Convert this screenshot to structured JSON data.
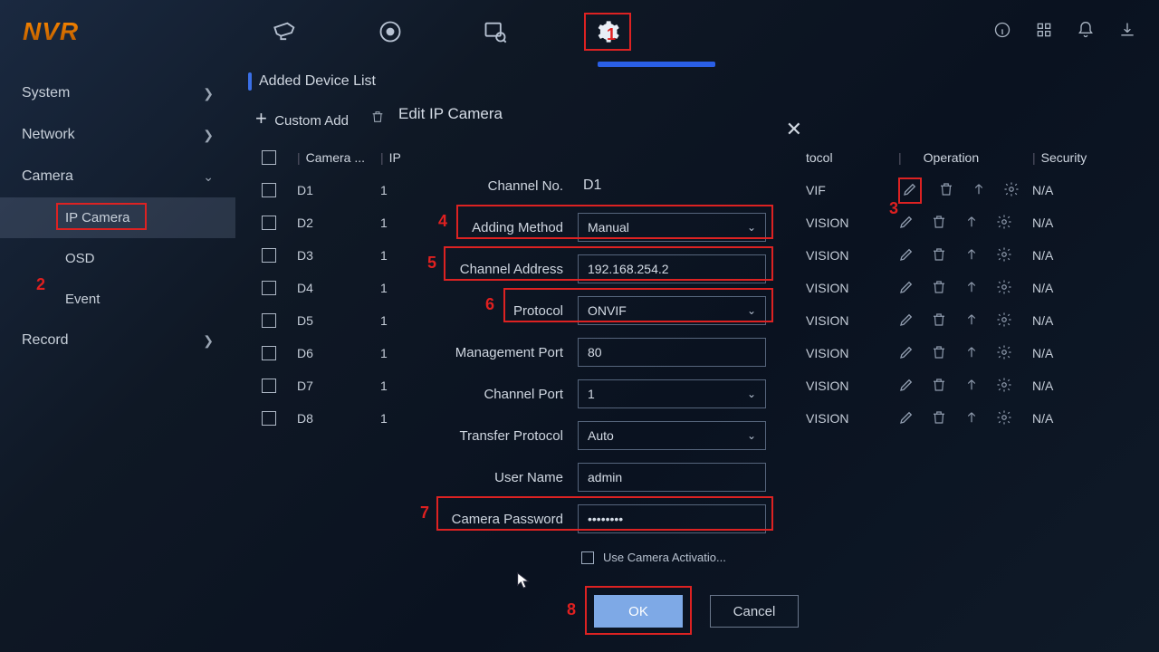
{
  "brand": "NVR",
  "topnav": {
    "icons": [
      "camera-icon",
      "play-circle-icon",
      "search-record-icon",
      "settings-icon"
    ]
  },
  "topright": {
    "icons": [
      "info-icon",
      "grid-icon",
      "bell-icon",
      "download-icon"
    ]
  },
  "sidebar": {
    "items": [
      {
        "label": "System",
        "expandable": true
      },
      {
        "label": "Network",
        "expandable": true
      },
      {
        "label": "Camera",
        "expandable": true,
        "expanded": true,
        "children": [
          {
            "label": "IP Camera",
            "active": true
          },
          {
            "label": "OSD"
          },
          {
            "label": "Event"
          }
        ]
      },
      {
        "label": "Record",
        "expandable": true
      }
    ]
  },
  "main": {
    "section_title": "Added Device List",
    "toolbar": {
      "custom_add": "Custom Add",
      "delete_label": ""
    },
    "columns": {
      "camera": "Camera ...",
      "ip": "IP",
      "protocol": "tocol",
      "operation": "Operation",
      "security": "Security"
    },
    "rows": [
      {
        "cam": "D1",
        "ip": "1",
        "proto": "VIF",
        "sec": "N/A"
      },
      {
        "cam": "D2",
        "ip": "1",
        "proto": "VISION",
        "sec": "N/A"
      },
      {
        "cam": "D3",
        "ip": "1",
        "proto": "VISION",
        "sec": "N/A"
      },
      {
        "cam": "D4",
        "ip": "1",
        "proto": "VISION",
        "sec": "N/A"
      },
      {
        "cam": "D5",
        "ip": "1",
        "proto": "VISION",
        "sec": "N/A"
      },
      {
        "cam": "D6",
        "ip": "1",
        "proto": "VISION",
        "sec": "N/A"
      },
      {
        "cam": "D7",
        "ip": "1",
        "proto": "VISION",
        "sec": "N/A"
      },
      {
        "cam": "D8",
        "ip": "1",
        "proto": "VISION",
        "sec": "N/A"
      }
    ]
  },
  "modal": {
    "title": "Edit IP Camera",
    "channel_no_label": "Channel No.",
    "channel_no_value": "D1",
    "fields": {
      "adding_method": {
        "label": "Adding Method",
        "value": "Manual",
        "type": "select"
      },
      "channel_address": {
        "label": "Channel Address",
        "value": "192.168.254.2",
        "type": "input"
      },
      "protocol": {
        "label": "Protocol",
        "value": "ONVIF",
        "type": "select"
      },
      "mgmt_port": {
        "label": "Management Port",
        "value": "80",
        "type": "input"
      },
      "channel_port": {
        "label": "Channel Port",
        "value": "1",
        "type": "select"
      },
      "transfer_proto": {
        "label": "Transfer Protocol",
        "value": "Auto",
        "type": "select"
      },
      "user_name": {
        "label": "User Name",
        "value": "admin",
        "type": "input"
      },
      "password": {
        "label": "Camera Password",
        "value": "••••••••",
        "type": "input"
      }
    },
    "use_activation": "Use Camera Activatio...",
    "ok": "OK",
    "cancel": "Cancel"
  },
  "annotations": {
    "n1": "1",
    "n2": "2",
    "n3": "3",
    "n4": "4",
    "n5": "5",
    "n6": "6",
    "n7": "7",
    "n8": "8"
  }
}
